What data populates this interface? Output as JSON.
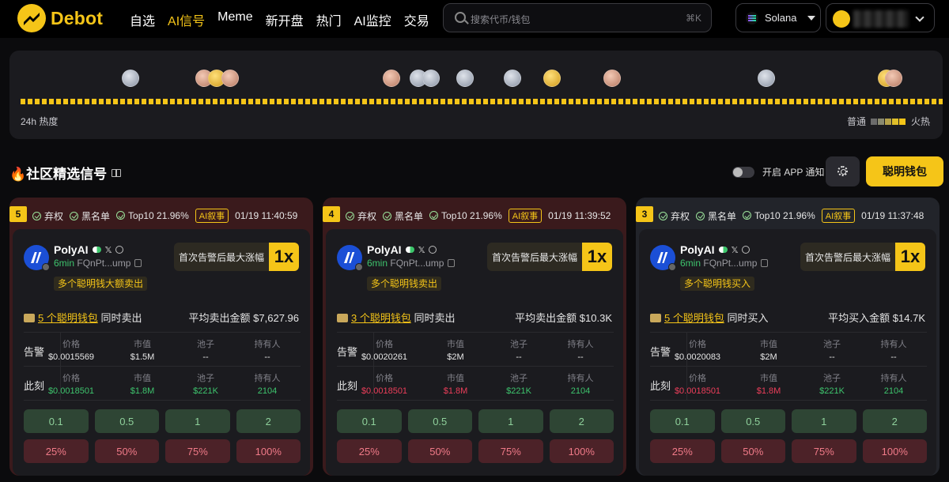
{
  "nav": {
    "logo": "Debot",
    "menu": [
      "自选",
      "AI信号",
      "Meme",
      "新开盘",
      "热门",
      "AI监控",
      "交易"
    ],
    "active_index": 1,
    "search_placeholder": "搜索代币/钱包",
    "search_shortcut": "⌘K",
    "chain": "Solana"
  },
  "heat": {
    "label": "24h 热度",
    "legend_low": "普通",
    "legend_high": "火热",
    "legend_colors": [
      "#6b6b6b",
      "#8a8a70",
      "#b5a24a",
      "#e0bf2a",
      "#f5c518"
    ]
  },
  "section": {
    "title": "🔥社区精选信号",
    "notify_label": "开启 APP 通知",
    "smart_wallet_button": "聪明钱包"
  },
  "cards": [
    {
      "rank": "5",
      "tag1": "弃权",
      "tag2": "黑名单",
      "tag3": "Top10 21.96%",
      "ai_tag": "AI叙事",
      "time": "01/19 11:40:59",
      "name": "PolyAI",
      "age": "6min",
      "address": "FQnPt...ump",
      "badge": "多个聪明钱大额卖出",
      "max_label": "首次告警后最大涨幅",
      "max_value": "1x",
      "summary_link": "5 个聪明钱包",
      "summary_action": "同时卖出",
      "avg_label": "平均卖出金额 $7,627.96",
      "alert_label": "告警",
      "now_label": "此刻",
      "headers": [
        "价格",
        "市值",
        "池子",
        "持有人"
      ],
      "alert": [
        "$0.0015569",
        "$1.5M",
        "--",
        "--"
      ],
      "now": [
        "$0.0018501",
        "$1.8M",
        "$221K",
        "2104"
      ],
      "buy_amounts": [
        "0.1",
        "0.5",
        "1",
        "2"
      ],
      "sell_pcts": [
        "25%",
        "50%",
        "75%",
        "100%"
      ]
    },
    {
      "rank": "4",
      "tag1": "弃权",
      "tag2": "黑名单",
      "tag3": "Top10 21.96%",
      "ai_tag": "AI叙事",
      "time": "01/19 11:39:52",
      "name": "PolyAI",
      "age": "6min",
      "address": "FQnPt...ump",
      "badge": "多个聪明钱卖出",
      "max_label": "首次告警后最大涨幅",
      "max_value": "1x",
      "summary_link": "3 个聪明钱包",
      "summary_action": "同时卖出",
      "avg_label": "平均卖出金额 $10.3K",
      "alert_label": "告警",
      "now_label": "此刻",
      "headers": [
        "价格",
        "市值",
        "池子",
        "持有人"
      ],
      "alert": [
        "$0.0020261",
        "$2M",
        "--",
        "--"
      ],
      "now": [
        "$0.0018501",
        "$1.8M",
        "$221K",
        "2104"
      ],
      "buy_amounts": [
        "0.1",
        "0.5",
        "1",
        "2"
      ],
      "sell_pcts": [
        "25%",
        "50%",
        "75%",
        "100%"
      ]
    },
    {
      "rank": "3",
      "tag1": "弃权",
      "tag2": "黑名单",
      "tag3": "Top10 21.96%",
      "ai_tag": "AI叙事",
      "time": "01/19 11:37:48",
      "name": "PolyAI",
      "age": "6min",
      "address": "FQnPt...ump",
      "badge": "多个聪明钱买入",
      "max_label": "首次告警后最大涨幅",
      "max_value": "1x",
      "summary_link": "5 个聪明钱包",
      "summary_action": "同时买入",
      "avg_label": "平均买入金额 $14.7K",
      "alert_label": "告警",
      "now_label": "此刻",
      "headers": [
        "价格",
        "市值",
        "池子",
        "持有人"
      ],
      "alert": [
        "$0.0020083",
        "$2M",
        "--",
        "--"
      ],
      "now": [
        "$0.0018501",
        "$1.8M",
        "$221K",
        "2104"
      ],
      "buy_amounts": [
        "0.1",
        "0.5",
        "1",
        "2"
      ],
      "sell_pcts": [
        "25%",
        "50%",
        "75%",
        "100%"
      ]
    }
  ]
}
